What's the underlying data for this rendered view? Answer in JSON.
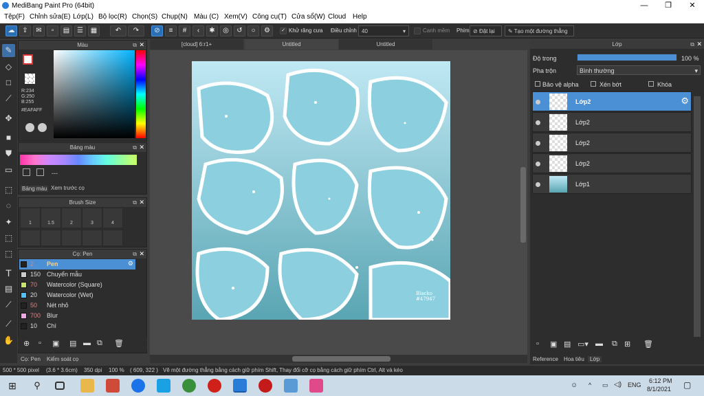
{
  "window": {
    "title": "MediBang Paint Pro (64bit)"
  },
  "menu": [
    "Tệp(F)",
    "Chỉnh sửa(E)",
    "Lớp(L)",
    "Bộ lọc(R)",
    "Chọn(S)",
    "Chụp(N)",
    "Màu (C)",
    "Xem(V)",
    "Công cụ(T)",
    "Cửa sổ(W)",
    "Cloud",
    "Help"
  ],
  "toolbar": {
    "antialias": "Khử răng cưa",
    "adjust_label": "Điều chỉnh",
    "adjust_value": "40",
    "snap": "Canh mềm",
    "keys": "Phím",
    "reset": "Đặt lại",
    "straight": "Tạo một đường thẳng"
  },
  "color_panel": {
    "title": "Màu",
    "r": "R:234",
    "g": "G:250",
    "b": "B:255",
    "hex": "#EAFAFF"
  },
  "palette_panel": {
    "title": "Bảng màu",
    "value": "---",
    "tab1": "Bảng màu",
    "tab2": "Xem trước cọ"
  },
  "brushsize_panel": {
    "title": "Brush Size",
    "sizes": [
      "1",
      "1.5",
      "2",
      "3",
      "4"
    ]
  },
  "brush_panel": {
    "title": "Cọ: Pen",
    "items": [
      {
        "num": "2",
        "name": "Pen",
        "color": "#222222"
      },
      {
        "num": "150",
        "name": "Chuyển mẫu",
        "color": "#cccccc"
      },
      {
        "num": "70",
        "name": "Watercolor (Square)",
        "color": "#c6e56a"
      },
      {
        "num": "20",
        "name": "Watercolor (Wet)",
        "color": "#4fc3f7"
      },
      {
        "num": "50",
        "name": "Nét nhỏ",
        "color": "#222222"
      },
      {
        "num": "700",
        "name": "Blur",
        "color": "#f3a6e6"
      },
      {
        "num": "10",
        "name": "Chì",
        "color": "#222222"
      }
    ],
    "tab1": "Cọ: Pen",
    "tab2": "Kiểm soát cọ"
  },
  "doc_tabs": [
    "[cloud] 6:r1+",
    "Untitled",
    "Untitled"
  ],
  "layer_panel": {
    "title": "Lớp",
    "opacity_label": "Độ trong",
    "opacity_value": "100 %",
    "blend_label": "Pha trộn",
    "blend_value": "Bình thường",
    "protect_alpha": "Bảo vệ alpha",
    "clip": "Xén bớt",
    "lock": "Khóa",
    "layers": [
      "Lớp2",
      "Lớp2",
      "Lớp2",
      "Lớp2",
      "Lớp1"
    ],
    "tabs": [
      "Reference",
      "Hoa tiêu",
      "Lớp"
    ]
  },
  "status": {
    "size": "500 * 500 pixel",
    "cm": "(3.6 * 3.6cm)",
    "dpi": "350 dpi",
    "zoom": "100 %",
    "coords": "( 609, 322 )",
    "hint": "Vẽ một đường thẳng bằng cách giữ phím Shift, Thay đổi cỡ cọ bằng cách giữ phím Ctrl, Alt và kéo"
  },
  "canvas": {
    "signature": "Blacko #47947"
  },
  "taskbar": {
    "lang": "ENG",
    "time": "6:12 PM",
    "date": "8/1/2021"
  }
}
